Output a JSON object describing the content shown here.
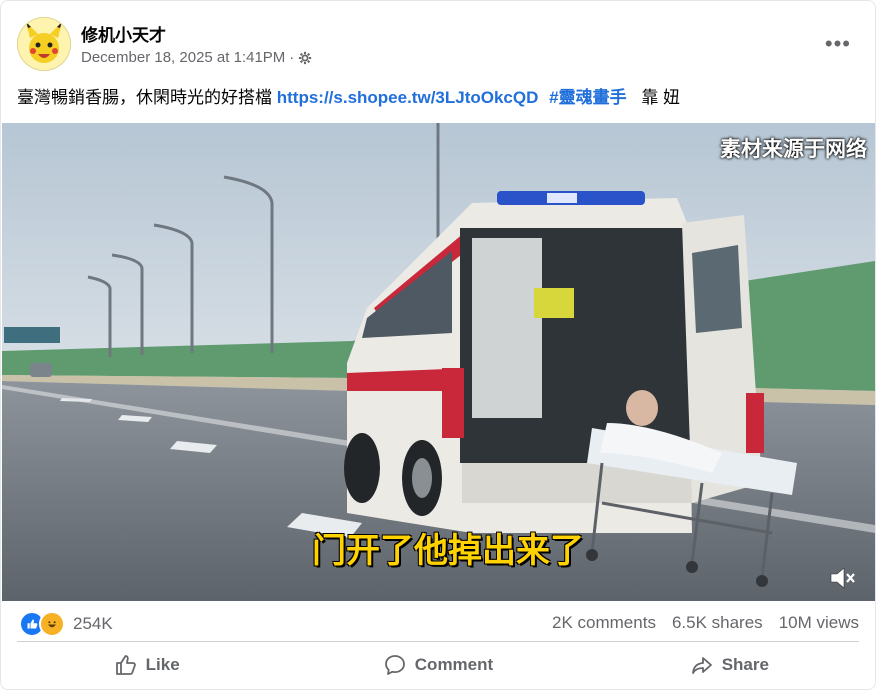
{
  "post": {
    "author": "修机小天才",
    "timestamp": "December 18, 2025 at 1:41PM",
    "meta_separator": "·",
    "text_prefix": "臺灣暢銷香腸，休閑時光的好搭檔",
    "link": "https://s.shopee.tw/3LJtoOkcQD",
    "hashtag": "#靈魂畫手",
    "text_suffix": "靠 妞"
  },
  "video": {
    "watermark": "素材来源于网络",
    "subtitle": "门开了他掉出来了"
  },
  "stats": {
    "reaction_count": "254K",
    "comments": "2K comments",
    "shares": "6.5K shares",
    "views": "10M views"
  },
  "actions": {
    "like": "Like",
    "comment": "Comment",
    "share": "Share"
  },
  "colors": {
    "link": "#216fdb",
    "muted_text": "#65676b",
    "like_blue": "#1877f2",
    "subtitle_yellow": "#ffd200"
  },
  "icons": [
    "avatar-pikachu",
    "globe-icon",
    "more-options-icon",
    "mute-icon",
    "like-reaction-icon",
    "haha-reaction-icon",
    "like-icon",
    "comment-icon",
    "share-icon"
  ]
}
